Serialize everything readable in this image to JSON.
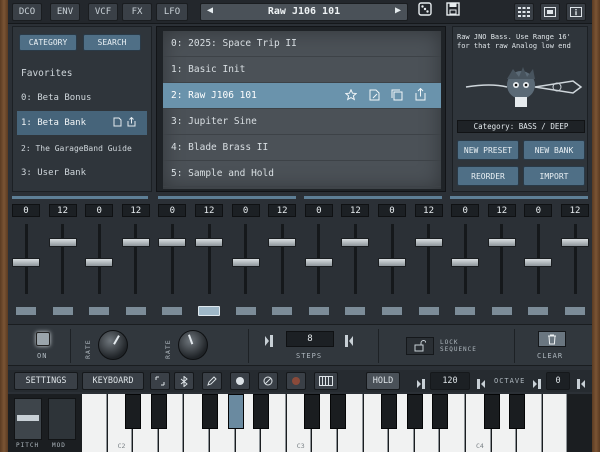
{
  "top": {
    "tabs": [
      "DCO",
      "ENV",
      "VCF",
      "FX",
      "LFO"
    ],
    "preset_name": "Raw J106 101",
    "prev_arrow": "◀",
    "next_arrow": "▶",
    "dice_icon": "⚅",
    "save_icon": "💾",
    "icons_right": [
      "grid-icon",
      "window-icon",
      "info-icon"
    ]
  },
  "left": {
    "category_btn": "CATEGORY",
    "search_btn": "SEARCH",
    "favorites": "Favorites",
    "banks": [
      "0: Beta Bonus",
      "1: Beta Bank",
      "2: The GarageBand Guide",
      "3: User Bank"
    ],
    "selected_bank": 1
  },
  "presets": {
    "items": [
      "0: 2025: Space Trip II",
      "1: Basic Init",
      "2: Raw J106 101",
      "3: Jupiter Sine",
      "4: Blade Brass II",
      "5: Sample and Hold"
    ],
    "selected": 2
  },
  "right": {
    "description": "Raw JNO Bass. Use Range 16' for that raw Analog low end",
    "category": "Category: BASS / DEEP",
    "buttons": [
      "NEW PRESET",
      "NEW BANK",
      "REORDER",
      "IMPORT"
    ]
  },
  "sequencer": {
    "values": [
      "0",
      "12",
      "0",
      "12",
      "0",
      "12",
      "0",
      "12",
      "0",
      "12",
      "0",
      "12",
      "0",
      "12",
      "0",
      "12"
    ],
    "active_step": 5
  },
  "controls": {
    "on_label": "ON",
    "rate1_label": "RATE",
    "rate2_label": "RATE",
    "steps_value": "8",
    "steps_label": "STEPS",
    "lock_label": "LOCK SEQUENCE",
    "clear_label": "CLEAR"
  },
  "toolbar": {
    "settings": "SETTINGS",
    "keyboard": "KEYBOARD",
    "hold": "HOLD",
    "tempo": "120",
    "octave_label": "OCTAVE",
    "octave": "0"
  },
  "keyboard": {
    "pitch_label": "PITCH",
    "mod_label": "MOD",
    "note_labels": [
      "C2",
      "C3",
      "C4"
    ]
  },
  "colors": {
    "accent": "#6a93ac",
    "button_blue": "#4f6f86",
    "panel": "#2f353b"
  }
}
